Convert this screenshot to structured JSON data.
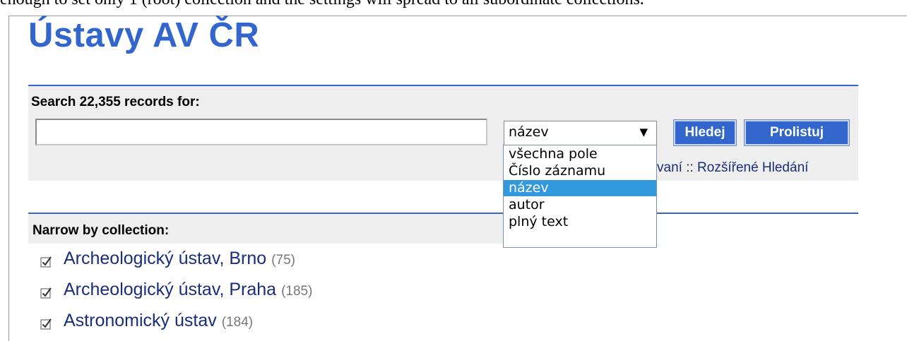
{
  "intro": {
    "text": "enough to set only 1 (root) collection and the settings will spread to all subordinate collections."
  },
  "page": {
    "title": "Ústavy AV ČR"
  },
  "search": {
    "heading": "Search 22,355 records for:",
    "query_value": "",
    "field_select": {
      "selected": "název",
      "options": [
        {
          "label": "všechna pole",
          "selected": false
        },
        {
          "label": "Číslo záznamu",
          "selected": false
        },
        {
          "label": "název",
          "selected": true
        },
        {
          "label": "autor",
          "selected": false
        },
        {
          "label": "plný text",
          "selected": false
        }
      ]
    },
    "search_button_label": "Hledej",
    "browse_button_label": "Prolistuj",
    "partial_link": "vaní",
    "separator": " :: ",
    "advanced_link": "Rozšířené Hledání"
  },
  "collections": {
    "heading": "Narrow by collection:",
    "items": [
      {
        "name": "Archeologický ústav, Brno",
        "count": "(75)",
        "checked": true
      },
      {
        "name": "Archeologický ústav, Praha",
        "count": "(185)",
        "checked": true
      },
      {
        "name": "Astronomický ústav",
        "count": "(184)",
        "checked": true
      }
    ]
  },
  "colors": {
    "accent": "#3366cc",
    "link": "#1a2d7a",
    "panel": "#eeeeee",
    "highlight": "#3399dd"
  },
  "icons": {
    "select_arrow": "triangle-down-icon",
    "checkbox": "checkbox-checked-icon"
  }
}
